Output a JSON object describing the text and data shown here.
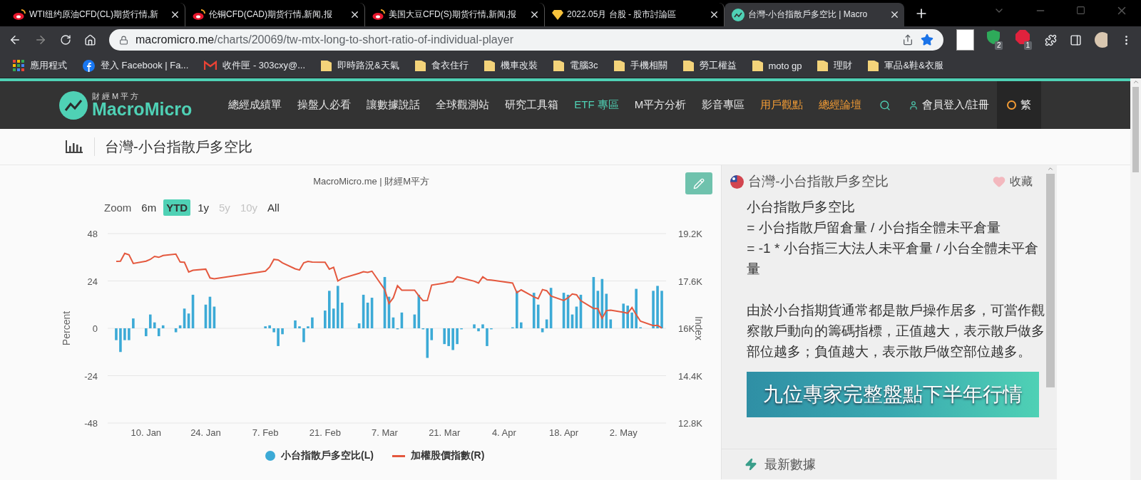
{
  "browser": {
    "tabs": [
      {
        "title": "WTI纽约原油CFD(CL)期货行情,新",
        "selected": false
      },
      {
        "title": "伦铜CFD(CAD)期货行情,新闻,报",
        "selected": false
      },
      {
        "title": "美国大豆CFD(S)期货行情,新闻,报",
        "selected": false
      },
      {
        "title": "2022.05月 台股 - 股市討論區",
        "selected": false
      },
      {
        "title": "台灣-小台指散戶多空比 | Macro",
        "selected": true
      }
    ],
    "address": {
      "host": "macromicro.me",
      "path": "/charts/20069/tw-mtx-long-to-short-ratio-of-individual-player"
    },
    "extension_badges": [
      "2",
      "1"
    ],
    "bookmarks": [
      {
        "label": "應用程式",
        "kind": "apps"
      },
      {
        "label": "登入 Facebook | Fa...",
        "kind": "facebook"
      },
      {
        "label": "收件匣 - 303cxy@...",
        "kind": "mail"
      },
      {
        "label": "即時路況&天氣",
        "kind": "folder"
      },
      {
        "label": "食衣住行",
        "kind": "folder"
      },
      {
        "label": "機車改裝",
        "kind": "folder"
      },
      {
        "label": "電腦3c",
        "kind": "folder"
      },
      {
        "label": "手機相關",
        "kind": "folder"
      },
      {
        "label": "勞工權益",
        "kind": "folder"
      },
      {
        "label": "moto gp",
        "kind": "folder"
      },
      {
        "label": "理財",
        "kind": "folder"
      },
      {
        "label": "軍品&鞋&衣服",
        "kind": "folder"
      }
    ]
  },
  "site": {
    "logo": {
      "tagline": "財經M平方",
      "name": "MacroMicro"
    },
    "nav": [
      {
        "label": "總經成績單",
        "color": "#e6e6e6"
      },
      {
        "label": "操盤人必看",
        "color": "#e6e6e6"
      },
      {
        "label": "讓數據說話",
        "color": "#e6e6e6"
      },
      {
        "label": "全球觀測站",
        "color": "#e6e6e6"
      },
      {
        "label": "研究工具箱",
        "color": "#e6e6e6"
      },
      {
        "label": "ETF 專區",
        "color": "#4fd1b5"
      },
      {
        "label": "M平方分析",
        "color": "#e6e6e6"
      },
      {
        "label": "影音專區",
        "color": "#e6e6e6"
      },
      {
        "label": "用戶觀點",
        "color": "#f39c35"
      },
      {
        "label": "總經論壇",
        "color": "#f39c35"
      }
    ],
    "login": "會員登入/註冊",
    "language": "繁"
  },
  "page_title": "台灣-小台指散戶多空比",
  "chart": {
    "credit": "MacroMicro.me | 財經M平方",
    "zoom_label": "Zoom",
    "ranges": [
      {
        "label": "6m",
        "selected": false,
        "disabled": false
      },
      {
        "label": "YTD",
        "selected": true,
        "disabled": false
      },
      {
        "label": "1y",
        "selected": false,
        "disabled": false
      },
      {
        "label": "5y",
        "selected": false,
        "disabled": true
      },
      {
        "label": "10y",
        "selected": false,
        "disabled": true
      },
      {
        "label": "All",
        "selected": false,
        "disabled": false
      }
    ],
    "percent": {
      "chart_data": {
        "type": "bar",
        "ylabel": "Percent",
        "grid": true,
        "x": [
          "2022-01-03",
          "2022-01-04",
          "2022-01-05",
          "2022-01-06",
          "2022-01-07",
          "2022-01-10",
          "2022-01-11",
          "2022-01-12",
          "2022-01-13",
          "2022-01-14",
          "2022-01-17",
          "2022-01-18",
          "2022-01-19",
          "2022-01-20",
          "2022-01-21",
          "2022-01-24",
          "2022-01-25",
          "2022-01-26",
          "2022-02-07",
          "2022-02-08",
          "2022-02-09",
          "2022-02-10",
          "2022-02-11",
          "2022-02-14",
          "2022-02-15",
          "2022-02-16",
          "2022-02-17",
          "2022-02-18",
          "2022-02-21",
          "2022-02-22",
          "2022-02-23",
          "2022-02-24",
          "2022-02-25",
          "2022-03-01",
          "2022-03-02",
          "2022-03-03",
          "2022-03-04",
          "2022-03-07",
          "2022-03-08",
          "2022-03-09",
          "2022-03-10",
          "2022-03-11",
          "2022-03-14",
          "2022-03-15",
          "2022-03-16",
          "2022-03-17",
          "2022-03-18",
          "2022-03-21",
          "2022-03-22",
          "2022-03-23",
          "2022-03-24",
          "2022-03-25",
          "2022-03-28",
          "2022-03-29",
          "2022-03-30",
          "2022-03-31",
          "2022-04-01",
          "2022-04-06",
          "2022-04-07",
          "2022-04-08",
          "2022-04-11",
          "2022-04-12",
          "2022-04-13",
          "2022-04-14",
          "2022-04-15",
          "2022-04-18",
          "2022-04-19",
          "2022-04-20",
          "2022-04-21",
          "2022-04-22",
          "2022-04-25",
          "2022-04-26",
          "2022-04-27",
          "2022-04-28",
          "2022-04-29",
          "2022-05-02",
          "2022-05-03",
          "2022-05-04",
          "2022-05-05",
          "2022-05-06",
          "2022-05-09",
          "2022-05-10",
          "2022-05-11"
        ],
        "series": [
          {
            "name": "小台指散戶多空比(L)",
            "color": "#3caad6",
            "values": [
              -6,
              -12,
              -6,
              -6,
              5,
              -4,
              7,
              3,
              -4,
              1.5,
              -2,
              1.5,
              10,
              7.5,
              17,
              12,
              16,
              11,
              1,
              1.5,
              -2,
              -9,
              -3,
              4,
              1,
              -7,
              1,
              5.5,
              9,
              19,
              10,
              21.5,
              13,
              2.5,
              17,
              13,
              15.5,
              26,
              16,
              5.5,
              -0.5,
              8,
              7,
              17,
              -0.5,
              -15,
              -6,
              -8,
              -9,
              -11,
              -8,
              -0.5,
              2,
              -1.5,
              2,
              -9,
              -0.5,
              0.5,
              19,
              3,
              18,
              12,
              -2,
              4.5,
              20.5,
              18,
              17,
              7,
              11,
              17,
              26,
              19,
              25,
              17.5,
              4.5,
              12.5,
              11.5,
              8,
              20,
              0.5,
              19,
              21.5,
              19
            ]
          }
        ],
        "xlim": [
          "2022-01-01",
          "2022-05-12"
        ],
        "ylim": [
          -48,
          48
        ],
        "yticks": [
          -48,
          -24,
          0,
          24,
          48
        ],
        "xticks": [
          {
            "value": "2022-01-10",
            "label": "10. Jan"
          },
          {
            "value": "2022-01-24",
            "label": "24. Jan"
          },
          {
            "value": "2022-02-07",
            "label": "7. Feb"
          },
          {
            "value": "2022-02-21",
            "label": "21. Feb"
          },
          {
            "value": "2022-03-07",
            "label": "7. Mar"
          },
          {
            "value": "2022-03-21",
            "label": "21. Mar"
          },
          {
            "value": "2022-04-04",
            "label": "4. Apr"
          },
          {
            "value": "2022-04-18",
            "label": "18. Apr"
          },
          {
            "value": "2022-05-02",
            "label": "2. May"
          }
        ]
      }
    },
    "index": {
      "chart_data": {
        "type": "line",
        "ylabel": "Index",
        "x": [
          "2022-01-03",
          "2022-01-04",
          "2022-01-05",
          "2022-01-06",
          "2022-01-07",
          "2022-01-10",
          "2022-01-11",
          "2022-01-12",
          "2022-01-13",
          "2022-01-14",
          "2022-01-17",
          "2022-01-18",
          "2022-01-19",
          "2022-01-20",
          "2022-01-21",
          "2022-01-24",
          "2022-01-25",
          "2022-01-26",
          "2022-02-07",
          "2022-02-08",
          "2022-02-09",
          "2022-02-10",
          "2022-02-11",
          "2022-02-14",
          "2022-02-15",
          "2022-02-16",
          "2022-02-17",
          "2022-02-18",
          "2022-02-21",
          "2022-02-22",
          "2022-02-23",
          "2022-02-24",
          "2022-02-25",
          "2022-03-01",
          "2022-03-02",
          "2022-03-03",
          "2022-03-04",
          "2022-03-07",
          "2022-03-08",
          "2022-03-09",
          "2022-03-10",
          "2022-03-11",
          "2022-03-14",
          "2022-03-15",
          "2022-03-16",
          "2022-03-17",
          "2022-03-18",
          "2022-03-21",
          "2022-03-22",
          "2022-03-23",
          "2022-03-24",
          "2022-03-25",
          "2022-03-28",
          "2022-03-29",
          "2022-03-30",
          "2022-03-31",
          "2022-04-01",
          "2022-04-06",
          "2022-04-07",
          "2022-04-08",
          "2022-04-11",
          "2022-04-12",
          "2022-04-13",
          "2022-04-14",
          "2022-04-15",
          "2022-04-18",
          "2022-04-19",
          "2022-04-20",
          "2022-04-21",
          "2022-04-22",
          "2022-04-25",
          "2022-04-26",
          "2022-04-27",
          "2022-04-28",
          "2022-04-29",
          "2022-05-02",
          "2022-05-03",
          "2022-05-04",
          "2022-05-05",
          "2022-05-06",
          "2022-05-09",
          "2022-05-10",
          "2022-05-11"
        ],
        "series": [
          {
            "name": "加權股價指數(R)",
            "color": "#e4583e",
            "values": [
              18260,
              18270,
              18530,
              18480,
              18190,
              18270,
              18330,
              18430,
              18400,
              18460,
              18510,
              18240,
              18230,
              17900,
              17960,
              18000,
              17700,
              17670,
              17930,
              18070,
              18330,
              18310,
              18210,
              18010,
              17970,
              18210,
              18260,
              18240,
              18230,
              18000,
              18060,
              17600,
              17690,
              17860,
              17910,
              17890,
              17930,
              17310,
              16840,
              17030,
              17440,
              17290,
              17290,
              17100,
              16930,
              16940,
              17460,
              17530,
              17570,
              17570,
              17740,
              17700,
              17590,
              17530,
              17740,
              17640,
              17630,
              17530,
              17200,
              17300,
              17060,
              17000,
              17310,
              17270,
              17090,
              16940,
              17030,
              17160,
              17130,
              16930,
              16670,
              16670,
              16340,
              16600,
              16610,
              16540,
              16510,
              16700,
              16460,
              16240,
              16090,
              16100,
              16010
            ]
          }
        ],
        "xlim": [
          "2022-01-01",
          "2022-05-12"
        ],
        "ylim": [
          12800,
          19200
        ],
        "yticks": [
          {
            "value": 12800,
            "label": "12.8K"
          },
          {
            "value": 14400,
            "label": "14.4K"
          },
          {
            "value": 16000,
            "label": "16K"
          },
          {
            "value": 17600,
            "label": "17.6K"
          },
          {
            "value": 19200,
            "label": "19.2K"
          }
        ]
      }
    }
  },
  "side_panel": {
    "title": "台灣-小台指散戶多空比",
    "favorite": "收藏",
    "formula": [
      "小台指散戶多空比",
      "= 小台指散戶留倉量 / 小台指全體未平倉量",
      "= -1 * 小台指三大法人未平倉量 / 小台全體未平倉量"
    ],
    "description": "由於小台指期貨通常都是散戶操作居多，可當作觀察散戶動向的籌碼指標，正值越大，表示散戶做多部位越多；負值越大，表示散戶做空部位越多。",
    "banner": "九位專家完整盤點下半年行情",
    "latest": "最新數據"
  }
}
